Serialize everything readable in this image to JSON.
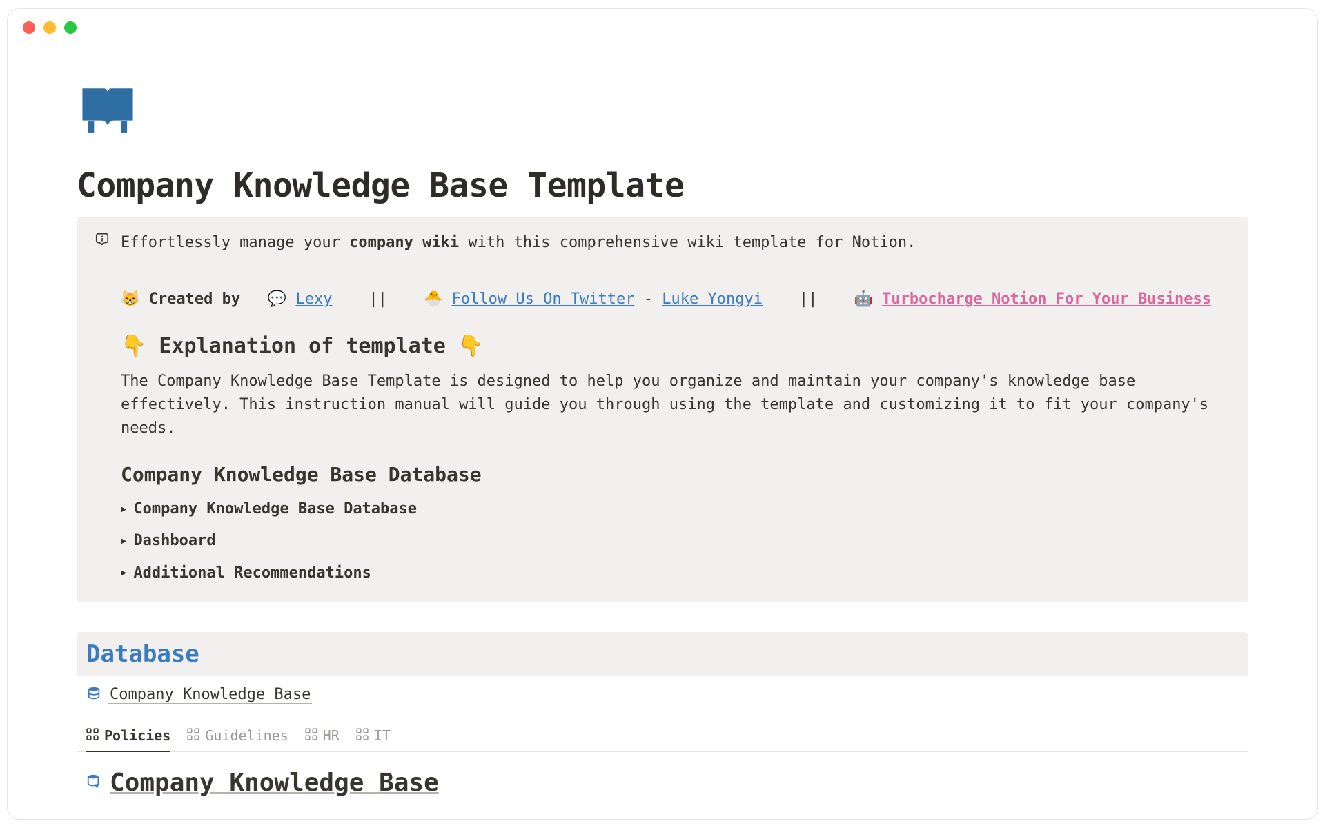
{
  "page": {
    "title": "Company Knowledge Base Template"
  },
  "callout": {
    "intro_pre": "Effortlessly manage your ",
    "intro_bold": "company wiki",
    "intro_post": " with this comprehensive wiki template for Notion.",
    "credits": {
      "created_by": "Created by",
      "lexy": "Lexy",
      "sep": "||",
      "twitter": "Follow Us On Twitter",
      "dash": " - ",
      "luke": "Luke Yongyi",
      "turbo": "Turbocharge Notion For Your Business"
    },
    "explain_head": "Explanation of template",
    "explain_body": "The Company Knowledge Base Template is designed to help you organize and maintain your company's knowledge base effectively. This instruction manual will guide you through using the template and customizing it to fit your company's needs.",
    "sub_head": "Company Knowledge Base Database",
    "toggles": [
      "Company Knowledge Base Database",
      "Dashboard",
      "Additional Recommendations"
    ]
  },
  "database": {
    "heading": "Database",
    "link_text": "Company Knowledge Base",
    "tabs": [
      "Policies",
      "Guidelines",
      "HR",
      "IT"
    ],
    "final_heading": "Company Knowledge Base"
  }
}
